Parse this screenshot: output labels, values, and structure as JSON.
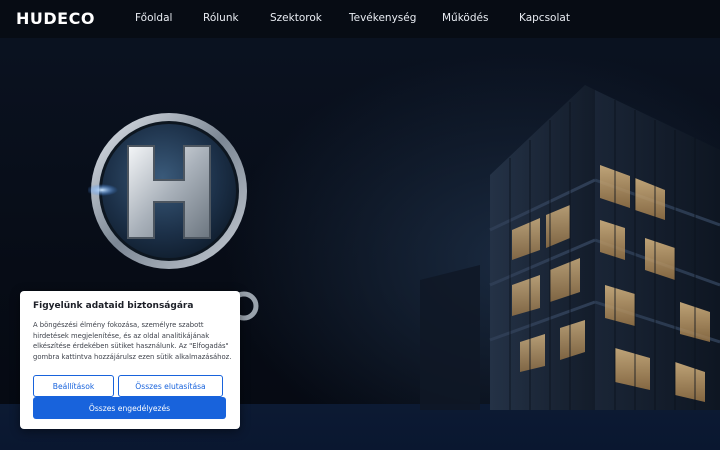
{
  "header": {
    "logo": "HUDECO",
    "nav": [
      {
        "label": "Főoldal"
      },
      {
        "label": "Rólunk"
      },
      {
        "label": "Szektorok"
      },
      {
        "label": "Tevékenység"
      },
      {
        "label": "Működés"
      },
      {
        "label": "Kapcsolat"
      }
    ]
  },
  "hero": {
    "emblem_letter": "H",
    "emblem_icon": "h-logo-emblem",
    "background_icon": "office-building-night"
  },
  "cookie_banner": {
    "title": "Figyelünk adataid biztonságára",
    "text": "A böngészési élmény fokozása, személyre szabott hirdetések megjelenítése, és az oldal analitikájának elkészítése érdekében sütiket használunk. Az \"Elfogadás\" gombra kattintva hozzájárulsz ezen sütik alkalmazásához.",
    "settings_label": "Beállítások",
    "reject_label": "Összes elutasítása",
    "accept_label": "Összes engedélyezés",
    "accent_color": "#1863dc"
  }
}
